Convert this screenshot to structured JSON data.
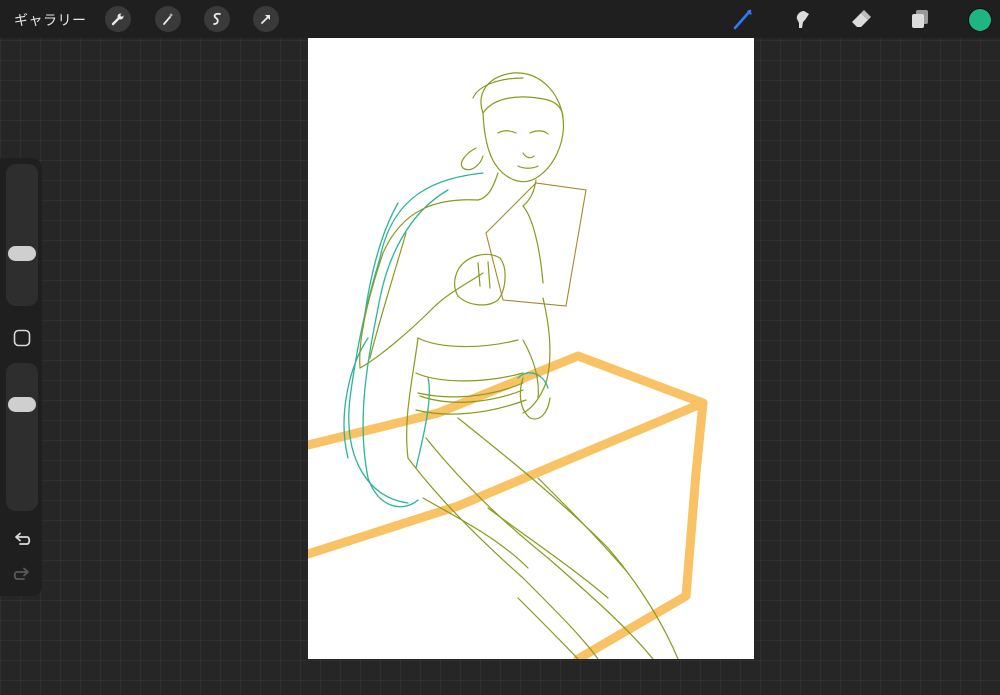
{
  "topbar": {
    "gallery_label": "ギャラリー",
    "left_tools": [
      "wrench-icon",
      "magic-wand-icon",
      "selection-icon",
      "transform-icon"
    ],
    "right_tools": [
      "brush-icon",
      "smudge-icon",
      "eraser-icon",
      "layers-icon"
    ],
    "active_tool": "brush-icon",
    "current_color": "#1db682",
    "accent_color": "#2f7bf5"
  },
  "sidebar": {
    "brush_size": 0.35,
    "opacity": 0.75,
    "undo_icon": "undo-icon",
    "redo_icon": "redo-icon"
  },
  "canvas": {
    "background": "#ffffff",
    "stroke_colors": [
      "#f7b13a",
      "#8a9a1a",
      "#2bb49a",
      "#a08a30"
    ]
  }
}
